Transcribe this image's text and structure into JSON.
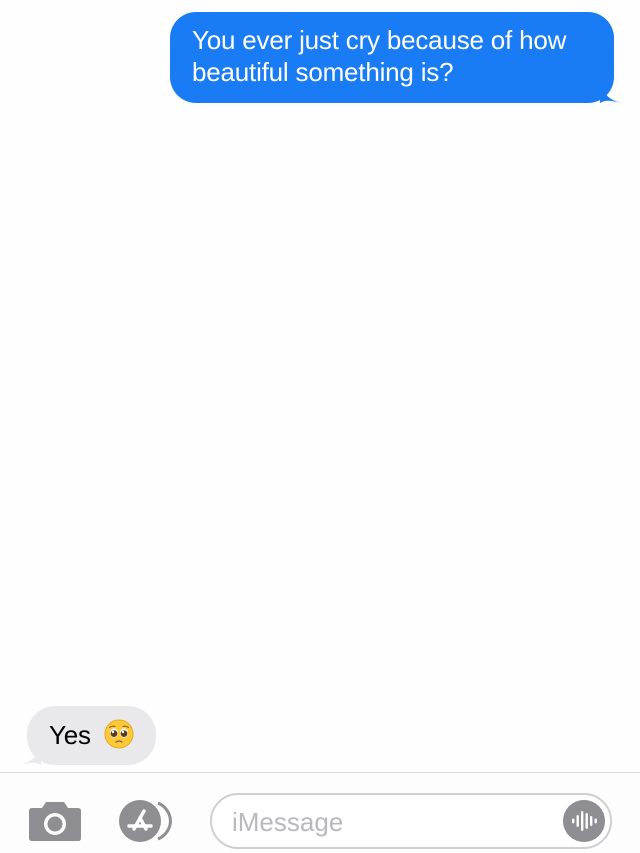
{
  "messages": {
    "sent": {
      "text": "You ever just cry because of how beautiful something is?"
    },
    "received": {
      "text": "Yes",
      "emoji": "pleading-face"
    }
  },
  "composer": {
    "placeholder": "iMessage",
    "camera_icon": "camera-icon",
    "apps_icon": "app-store-icon",
    "audio_icon": "audio-waveform-icon"
  },
  "colors": {
    "sent_bubble": "#1a7cf5",
    "received_bubble": "#e9e9eb",
    "icon_gray": "#8e8e93"
  }
}
